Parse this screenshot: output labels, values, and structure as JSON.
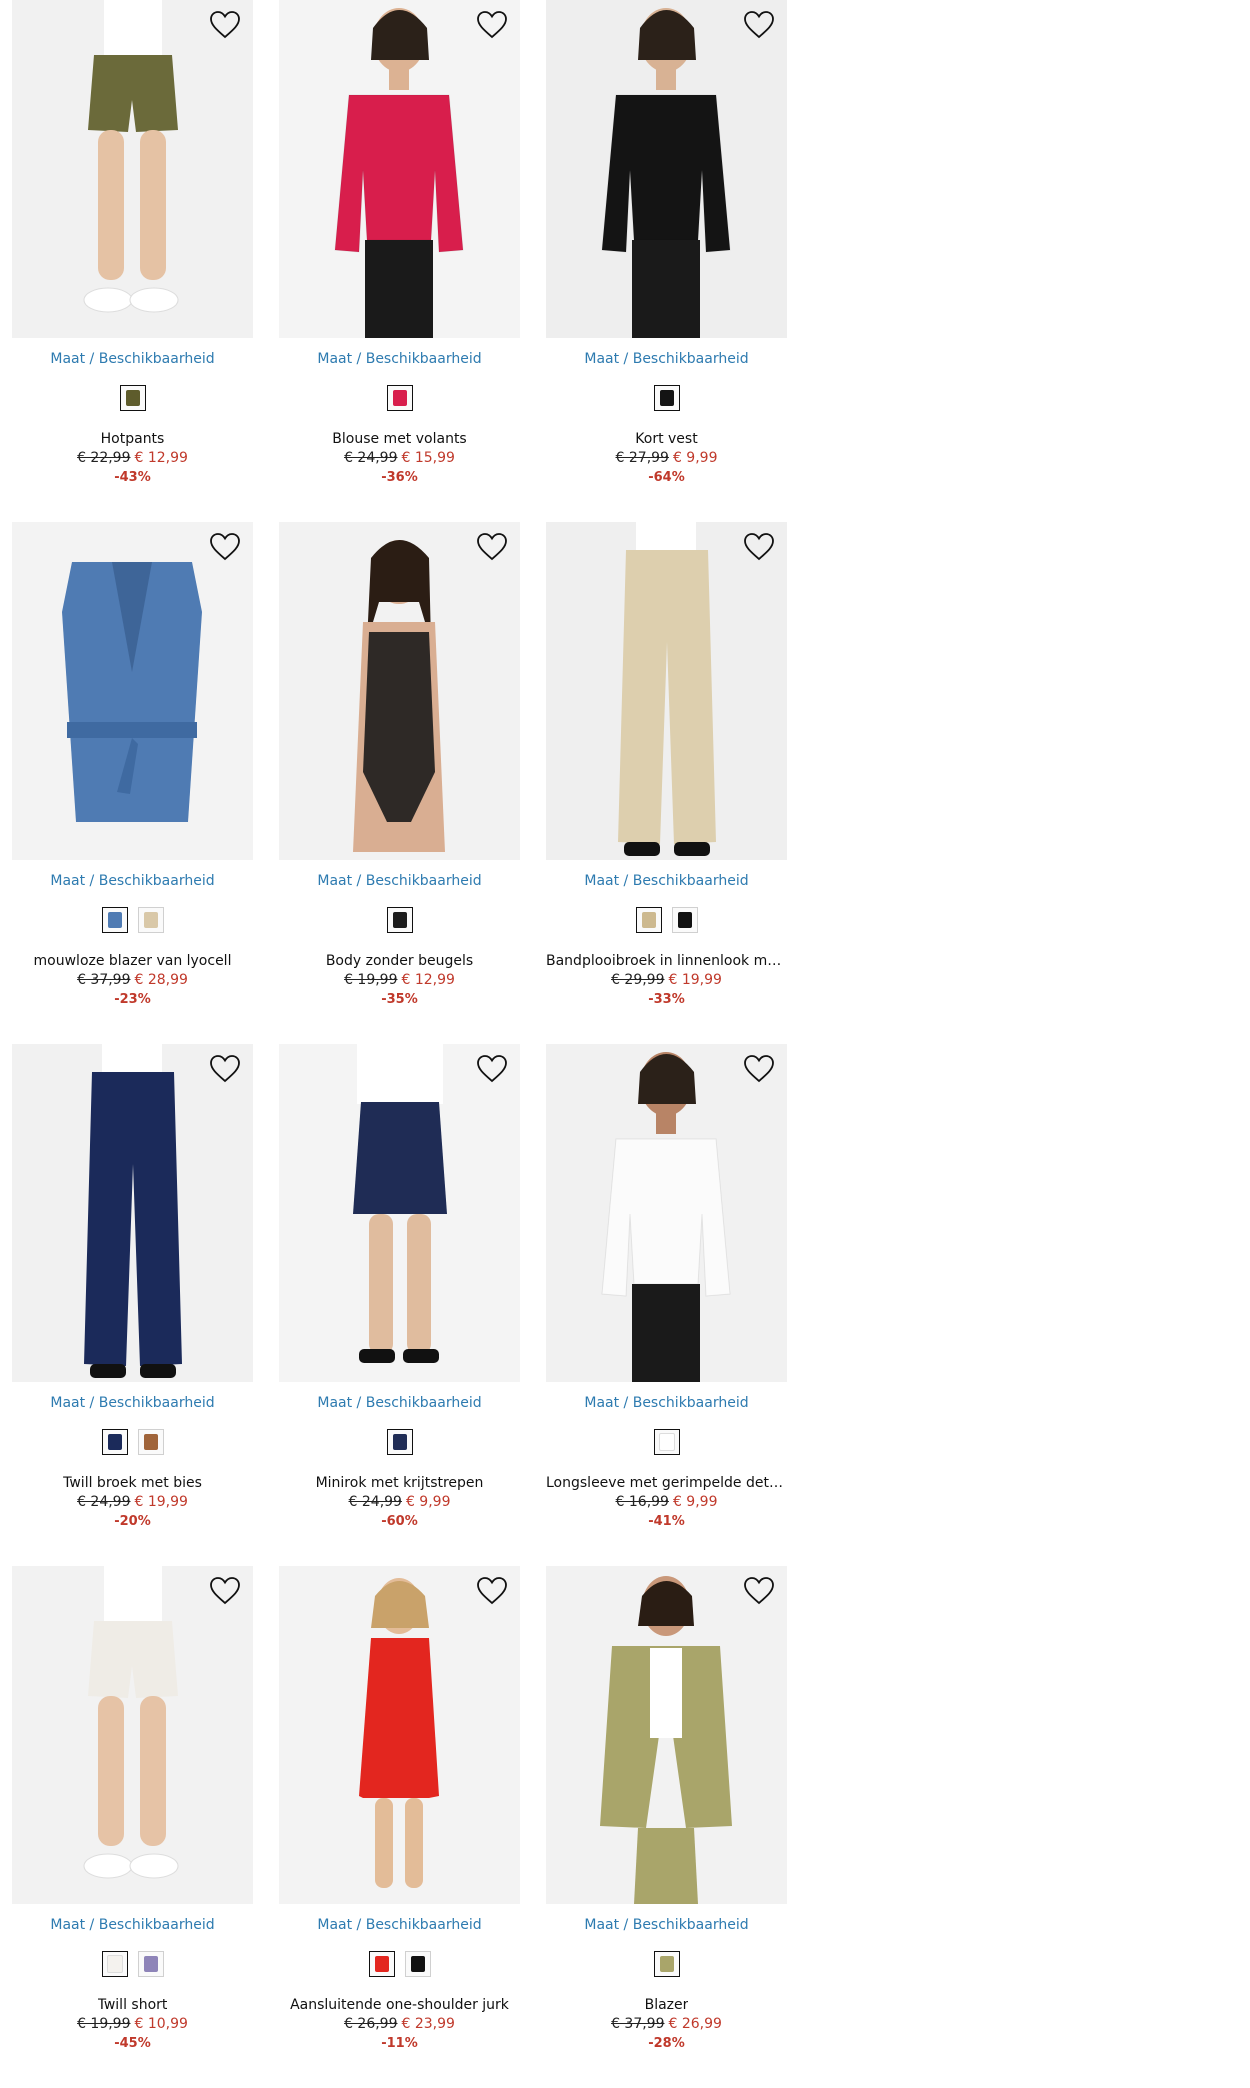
{
  "availability_label": "Maat / Beschikbaarheid",
  "products": [
    {
      "name": "Hotpants",
      "old_price": "€ 22,99",
      "new_price": "€ 12,99",
      "discount": "-43%",
      "bg": "#f1f1f1",
      "garment": "#6b6a3a",
      "skin": "#e5c2a4",
      "type": "shorts",
      "swatches": [
        {
          "color": "#5e5c2c",
          "selected": true
        }
      ]
    },
    {
      "name": "Blouse met volants",
      "old_price": "€ 24,99",
      "new_price": "€ 15,99",
      "discount": "-36%",
      "bg": "#f4f4f4",
      "garment": "#d81e4c",
      "skin": "#dcb293",
      "type": "top",
      "swatches": [
        {
          "color": "#d81e4c",
          "selected": true
        }
      ]
    },
    {
      "name": "Kort vest",
      "old_price": "€ 27,99",
      "new_price": "€ 9,99",
      "discount": "-64%",
      "bg": "#eeeeee",
      "garment": "#141414",
      "skin": "#d8b294",
      "type": "top",
      "swatches": [
        {
          "color": "#141414",
          "selected": true
        }
      ]
    },
    {
      "name": "mouwloze blazer van lyocell",
      "old_price": "€ 37,99",
      "new_price": "€ 28,99",
      "discount": "-23%",
      "bg": "#f3f3f3",
      "garment": "#4f7bb3",
      "skin": "#f3f3f3",
      "type": "vest",
      "swatches": [
        {
          "color": "#4f7bb3",
          "selected": true
        },
        {
          "color": "#d9c8a8",
          "selected": false
        }
      ]
    },
    {
      "name": "Body zonder beugels",
      "old_price": "€ 19,99",
      "new_price": "€ 12,99",
      "discount": "-35%",
      "bg": "#f2f2f2",
      "garment": "#1b1b1b",
      "skin": "#d9ae92",
      "type": "body",
      "swatches": [
        {
          "color": "#1b1b1b",
          "selected": true
        }
      ]
    },
    {
      "name": "Bandplooibroek in linnenlook met …",
      "old_price": "€ 29,99",
      "new_price": "€ 19,99",
      "discount": "-33%",
      "bg": "#efefef",
      "garment": "#ddcfae",
      "skin": "#e2bfa2",
      "type": "pants",
      "swatches": [
        {
          "color": "#cdb98f",
          "selected": true
        },
        {
          "color": "#111111",
          "selected": false
        }
      ]
    },
    {
      "name": "Twill broek met bies",
      "old_price": "€ 24,99",
      "new_price": "€ 19,99",
      "discount": "-20%",
      "bg": "#f1f1f1",
      "garment": "#1b2a5a",
      "skin": "#e4c0a2",
      "type": "pants",
      "swatches": [
        {
          "color": "#1b2a5a",
          "selected": true
        },
        {
          "color": "#a0643a",
          "selected": false
        }
      ]
    },
    {
      "name": "Minirok met krijtstrepen",
      "old_price": "€ 24,99",
      "new_price": "€ 9,99",
      "discount": "-60%",
      "bg": "#f4f4f4",
      "garment": "#1f2c55",
      "skin": "#e0bc9e",
      "type": "skirt",
      "swatches": [
        {
          "color": "#1f2c55",
          "selected": true
        }
      ]
    },
    {
      "name": "Longsleeve met gerimpelde details",
      "old_price": "€ 16,99",
      "new_price": "€ 9,99",
      "discount": "-41%",
      "bg": "#f1f1f1",
      "garment": "#fbfbfb",
      "skin": "#b88466",
      "type": "top",
      "swatches": [
        {
          "color": "#ffffff",
          "selected": true
        }
      ]
    },
    {
      "name": "Twill short",
      "old_price": "€ 19,99",
      "new_price": "€ 10,99",
      "discount": "-45%",
      "bg": "#f2f2f2",
      "garment": "#efece6",
      "skin": "#e6c3a6",
      "type": "shorts",
      "swatches": [
        {
          "color": "#f4f2ee",
          "selected": true
        },
        {
          "color": "#8e84b8",
          "selected": false
        }
      ]
    },
    {
      "name": "Aansluitende one-shoulder jurk",
      "old_price": "€ 26,99",
      "new_price": "€ 23,99",
      "discount": "-11%",
      "bg": "#f3f3f3",
      "garment": "#e3261f",
      "skin": "#e3bc98",
      "type": "dress",
      "swatches": [
        {
          "color": "#e3261f",
          "selected": true
        },
        {
          "color": "#111111",
          "selected": false
        }
      ]
    },
    {
      "name": "Blazer",
      "old_price": "€ 37,99",
      "new_price": "€ 26,99",
      "discount": "-28%",
      "bg": "#f2f2f2",
      "garment": "#a9a56a",
      "skin": "#c9987a",
      "type": "blazer",
      "swatches": [
        {
          "color": "#a9a56a",
          "selected": true
        }
      ]
    }
  ]
}
